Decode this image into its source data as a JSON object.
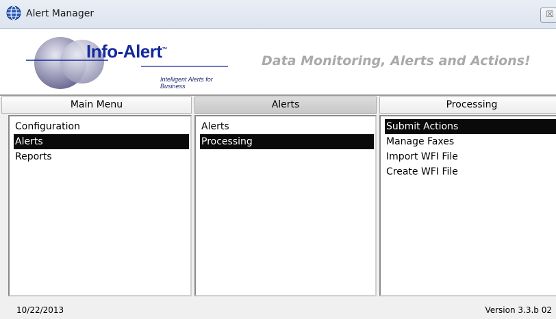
{
  "window": {
    "title": "Alert Manager",
    "icon": "globe-app-icon",
    "close_glyph": "☒"
  },
  "banner": {
    "logo_text": "Info-Alert",
    "logo_tm": "™",
    "logo_tagline": "Intelligent Alerts for Business",
    "slogan": "Data Monitoring, Alerts and Actions!"
  },
  "columns": [
    {
      "header": "Main Menu",
      "active": false,
      "items": [
        {
          "label": "Configuration",
          "selected": false
        },
        {
          "label": "Alerts",
          "selected": true
        },
        {
          "label": "Reports",
          "selected": false
        }
      ]
    },
    {
      "header": "Alerts",
      "active": true,
      "items": [
        {
          "label": "Alerts",
          "selected": false
        },
        {
          "label": "Processing",
          "selected": true
        }
      ]
    },
    {
      "header": "Processing",
      "active": false,
      "items": [
        {
          "label": "Submit Actions",
          "selected": true
        },
        {
          "label": "Manage Faxes",
          "selected": false
        },
        {
          "label": "Import WFI File",
          "selected": false
        },
        {
          "label": "Create WFI File",
          "selected": false
        }
      ]
    }
  ],
  "status": {
    "date": "10/22/2013",
    "version": "Version 3.3.b 02"
  },
  "colors": {
    "logo_blue": "#142a9c",
    "slogan_gray": "#a9a9a9",
    "selection_bg": "#0a0a0a"
  }
}
